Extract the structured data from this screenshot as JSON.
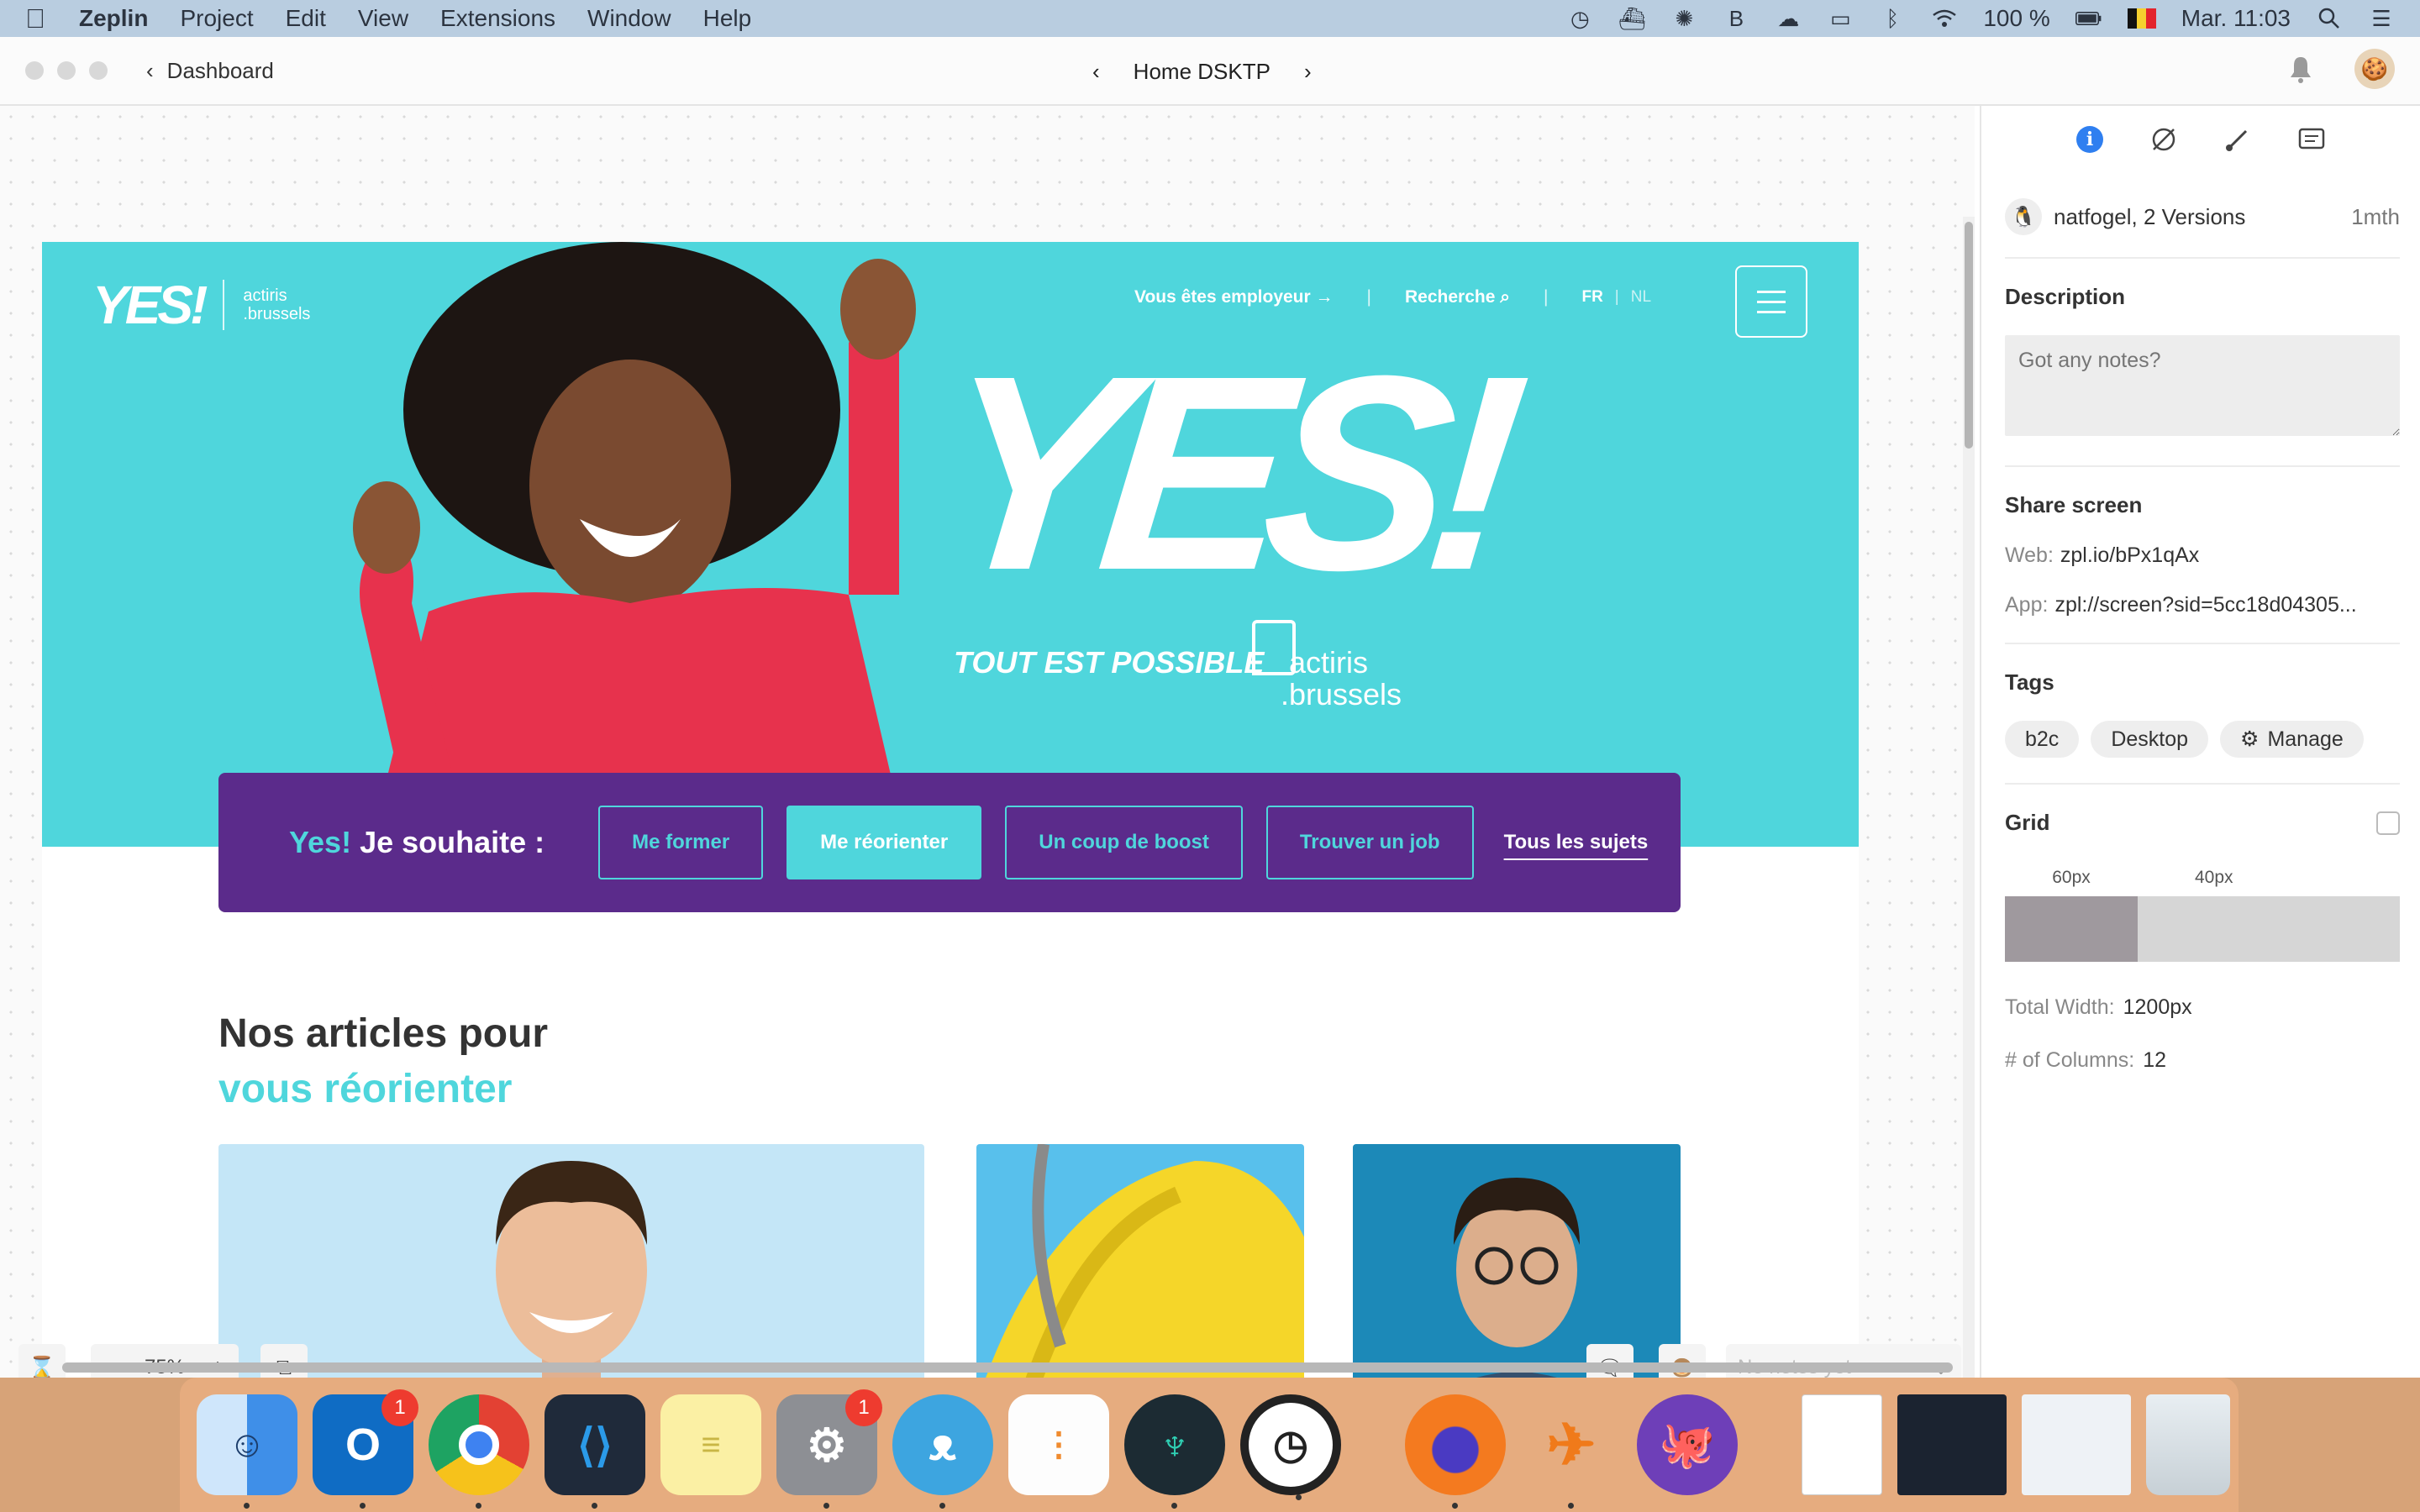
{
  "menubar": {
    "app": "Zeplin",
    "items": [
      "Project",
      "Edit",
      "View",
      "Extensions",
      "Window",
      "Help"
    ],
    "battery": "100 %",
    "clock": "Mar. 11:03"
  },
  "titlebar": {
    "back_label": "Dashboard",
    "screen_title": "Home DSKTP"
  },
  "artboard": {
    "logo_small": "YES!",
    "actiris_small_1": "actiris",
    "actiris_small_2": ".brussels",
    "nav_employer": "Vous êtes employeur",
    "nav_search": "Recherche",
    "lang_fr": "FR",
    "lang_nl": "NL",
    "big_yes": "YES!",
    "tagline": "TOUT EST POSSIBLE",
    "actiris_big_1": "actiris",
    "actiris_big_2": ".brussels",
    "cta_accent": "Yes!",
    "cta_rest": "Je souhaite :",
    "pills": [
      "Me former",
      "Me réorienter",
      "Un coup de boost",
      "Trouver un job"
    ],
    "all_topics": "Tous les sujets",
    "section_title_1": "Nos articles pour",
    "section_title_2": "vous réorienter"
  },
  "canvas_tools": {
    "zoom": "75%",
    "notes_placeholder": "No notes yet"
  },
  "inspector": {
    "author": "natfogel, 2 Versions",
    "age": "1mth",
    "description_title": "Description",
    "notes_placeholder": "Got any notes?",
    "share_title": "Share screen",
    "web_label": "Web:",
    "web_value": "zpl.io/bPx1qAx",
    "app_label": "App:",
    "app_value": "zpl://screen?sid=5cc18d04305...",
    "tags_title": "Tags",
    "tags": [
      "b2c",
      "Desktop"
    ],
    "manage_label": "Manage",
    "grid_title": "Grid",
    "grid_col_label": "60px",
    "grid_gutter_label": "40px",
    "total_width_label": "Total Width:",
    "total_width_value": "1200px",
    "columns_label": "# of Columns:",
    "columns_value": "12"
  },
  "dock": {
    "outlook_badge": "1",
    "prefs_badge": "1"
  },
  "colors": {
    "hero_cyan": "#4fd6dc",
    "purple": "#5b2b8b",
    "info_blue": "#2f7ff0"
  }
}
